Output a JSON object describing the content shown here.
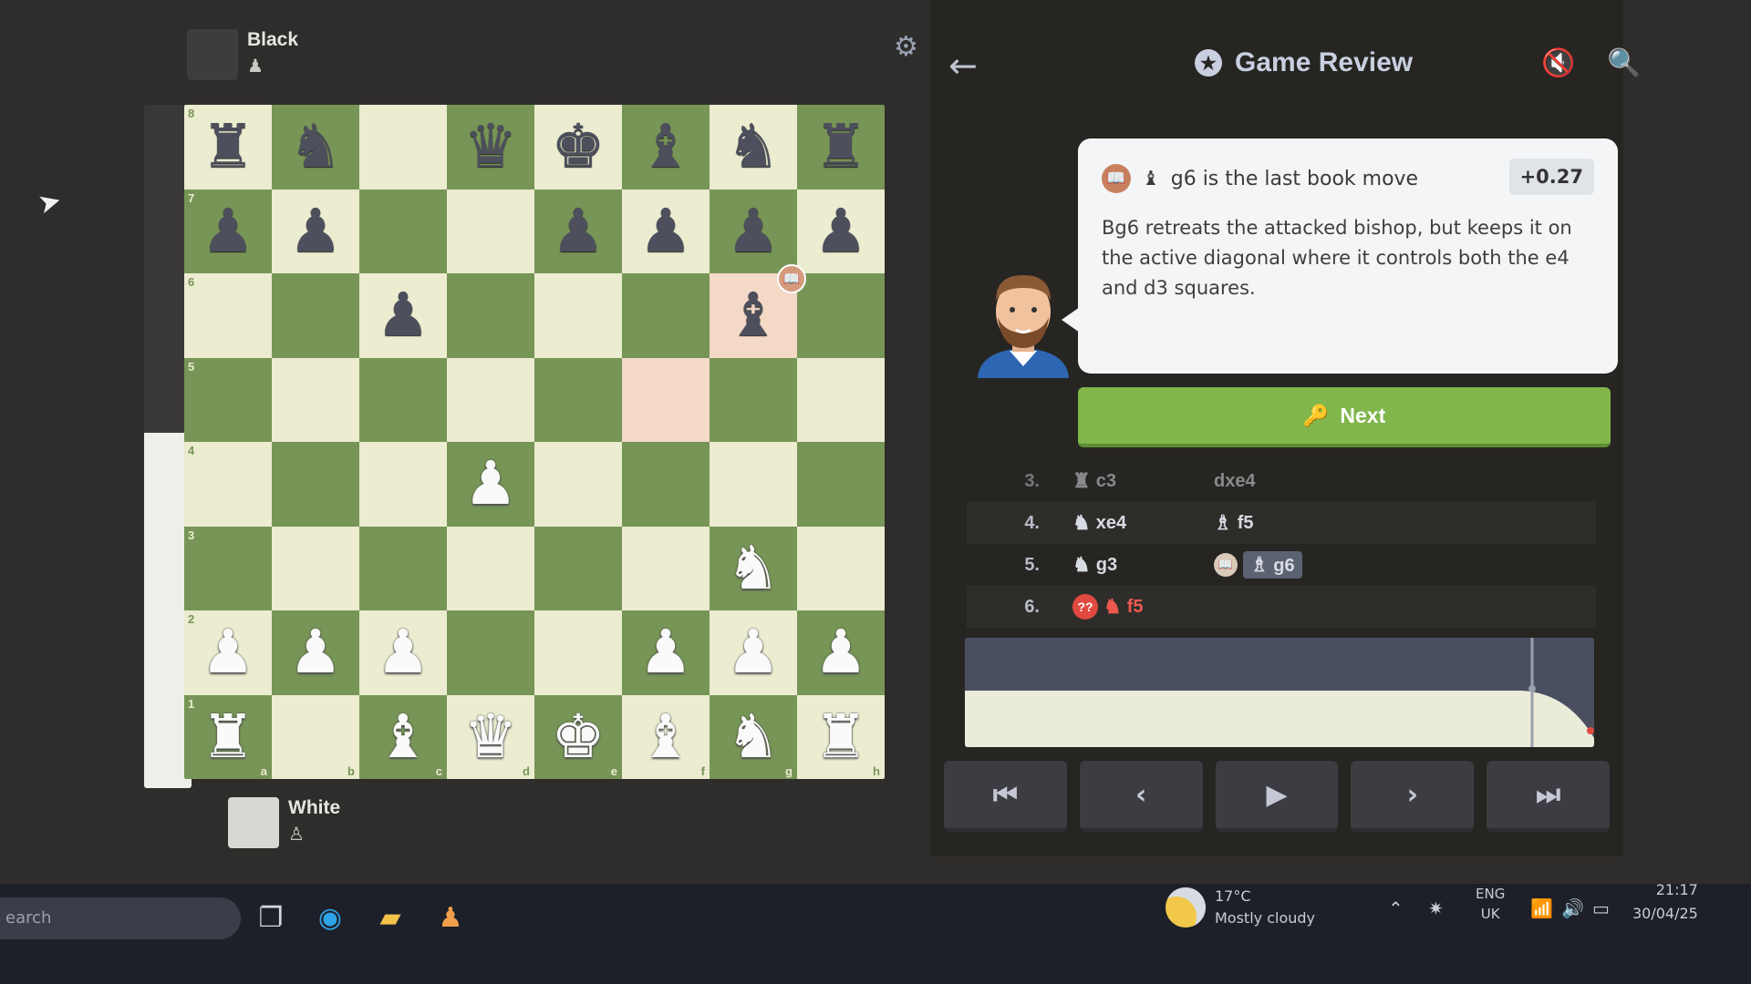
{
  "players": {
    "top": {
      "name": "Black"
    },
    "bottom": {
      "name": "White"
    }
  },
  "eval_bar": {
    "white_fraction": 0.52
  },
  "board": {
    "files": [
      "a",
      "b",
      "c",
      "d",
      "e",
      "f",
      "g",
      "h"
    ],
    "ranks": [
      "8",
      "7",
      "6",
      "5",
      "4",
      "3",
      "2",
      "1"
    ],
    "rows": [
      [
        "bR",
        "bN",
        "",
        "bQ",
        "bK",
        "bB",
        "bN",
        "bR"
      ],
      [
        "bP",
        "bP",
        "",
        "",
        "bP",
        "bP",
        "bP",
        "bP"
      ],
      [
        "",
        "",
        "bP",
        "",
        "",
        "",
        "bB",
        ""
      ],
      [
        "",
        "",
        "",
        "",
        "",
        "",
        "",
        ""
      ],
      [
        "",
        "",
        "",
        "wP",
        "",
        "",
        "",
        ""
      ],
      [
        "",
        "",
        "",
        "",
        "",
        "",
        "wN",
        ""
      ],
      [
        "wP",
        "wP",
        "wP",
        "",
        "",
        "wP",
        "wP",
        "wP"
      ],
      [
        "wR",
        "",
        "wB",
        "wQ",
        "wK",
        "wB",
        "wN",
        "wR"
      ]
    ],
    "highlight": [
      "f5",
      "g6"
    ],
    "book_badge_square": "g6"
  },
  "header": {
    "title": "Game Review"
  },
  "coach": {
    "headline": "g6 is the last book move",
    "eval": "+0.27",
    "text": "Bg6 retreats the attacked bishop, but keeps it on the active diagonal where it controls both the e4 and d3 squares."
  },
  "next_button": {
    "label": "Next"
  },
  "moves": [
    {
      "num": "3.",
      "white": "c3",
      "black": "dxe4"
    },
    {
      "num": "4.",
      "white": "xe4",
      "black": "f5"
    },
    {
      "num": "5.",
      "white": "g3",
      "black": "g6"
    },
    {
      "num": "6.",
      "white": "f5",
      "black": ""
    }
  ],
  "blunder_mark": "??",
  "taskbar": {
    "search_placeholder": "earch",
    "weather_temp": "17°C",
    "weather_desc": "Mostly cloudy",
    "lang_1": "ENG",
    "lang_2": "UK",
    "time": "21:17",
    "date": "30/04/25"
  },
  "colors": {
    "board_light": "#ebecd0",
    "board_dark": "#779556",
    "next_green": "#81b64c",
    "blunder_red": "#e0493f"
  },
  "icons": {
    "settings": "gear-icon",
    "back": "arrow-left-icon",
    "review": "star-icon",
    "sound": "sound-off-icon",
    "search": "magnifier-icon"
  }
}
